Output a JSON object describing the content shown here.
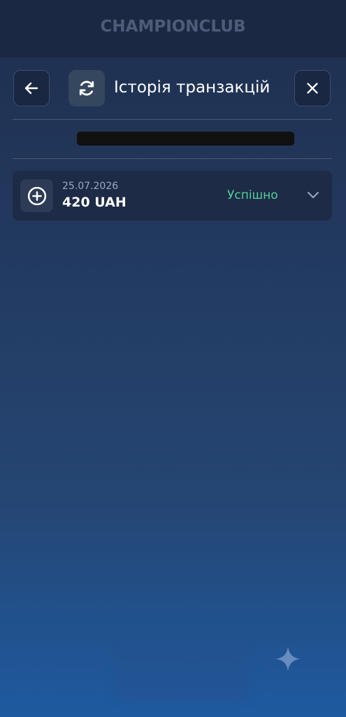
{
  "brand": {
    "logo_text": "ChampionClub"
  },
  "header": {
    "title": "Історія транзакцій",
    "back_icon": "arrow-left-icon",
    "refresh_icon": "refresh-icon",
    "close_icon": "close-icon"
  },
  "transactions": [
    {
      "date": "25.07.2026",
      "amount": "420 UAH",
      "status": "Успішно",
      "icon": "plus-circle-icon",
      "expand_icon": "chevron-down-icon"
    }
  ],
  "colors": {
    "background_top": "#1f2f4e",
    "background_bottom": "#1e5aa0",
    "topbar": "#1b2844",
    "card": "#1e2b46",
    "status_success": "#4fd39a",
    "redaction": "#111111"
  }
}
